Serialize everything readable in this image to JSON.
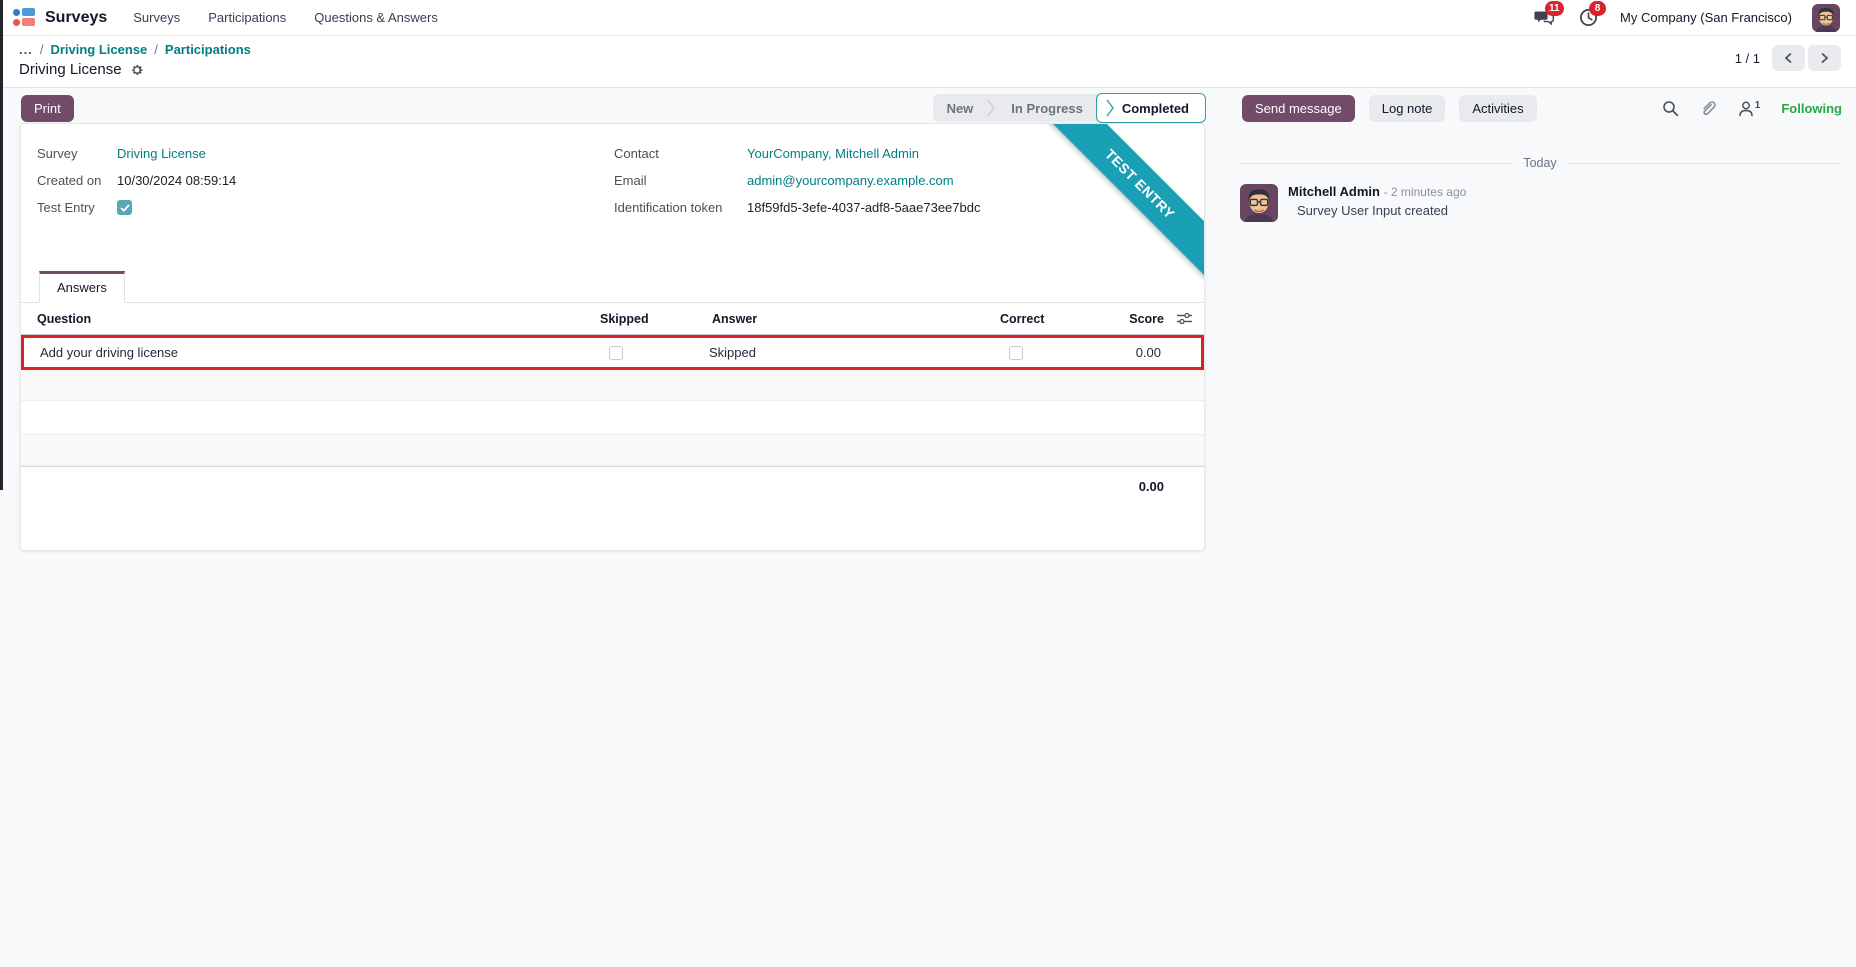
{
  "navbar": {
    "app_name": "Surveys",
    "menus": [
      {
        "label": "Surveys"
      },
      {
        "label": "Participations"
      },
      {
        "label": "Questions & Answers"
      }
    ],
    "messages_badge": "11",
    "activities_badge": "8",
    "company": "My Company (San Francisco)"
  },
  "breadcrumb": {
    "ellipsis": "...",
    "separator": "/",
    "parent": "Driving License",
    "current": "Participations",
    "pager_text": "1 / 1"
  },
  "page_title": "Driving License",
  "control_panel": {
    "print_label": "Print",
    "stages": {
      "new": "New",
      "in_progress": "In Progress",
      "completed": "Completed"
    },
    "send_message_label": "Send message",
    "log_note_label": "Log note",
    "activities_label": "Activities",
    "follower_count": "1",
    "following_label": "Following"
  },
  "form": {
    "ribbon": "TEST ENTRY",
    "fields_left": {
      "survey": {
        "label": "Survey",
        "value": "Driving License"
      },
      "created_on": {
        "label": "Created on",
        "value": "10/30/2024 08:59:14"
      },
      "test_entry": {
        "label": "Test Entry",
        "checked": true
      }
    },
    "fields_right": {
      "contact": {
        "label": "Contact",
        "value": "YourCompany, Mitchell Admin"
      },
      "email": {
        "label": "Email",
        "value": "admin@yourcompany.example.com"
      },
      "token": {
        "label": "Identification token",
        "value": "18f59fd5-3efe-4037-adf8-5aae73ee7bdc"
      }
    },
    "tab_label": "Answers",
    "table": {
      "headers": {
        "question": "Question",
        "skipped": "Skipped",
        "answer": "Answer",
        "correct": "Correct",
        "score": "Score"
      },
      "rows": [
        {
          "question": "Add your driving license",
          "skipped": false,
          "answer": "Skipped",
          "correct": false,
          "score": "0.00",
          "highlighted": true
        }
      ],
      "total_score": "0.00"
    }
  },
  "chatter": {
    "date_divider": "Today",
    "messages": [
      {
        "author": "Mitchell Admin",
        "time": "- 2 minutes ago",
        "body": "Survey User Input created"
      }
    ]
  },
  "colors": {
    "primary": "#714B67",
    "link": "#017e84",
    "ribbon": "#1aa0b5",
    "highlight_red": "#e02020",
    "following_green": "#28a745",
    "badge_red": "#d9232d"
  }
}
